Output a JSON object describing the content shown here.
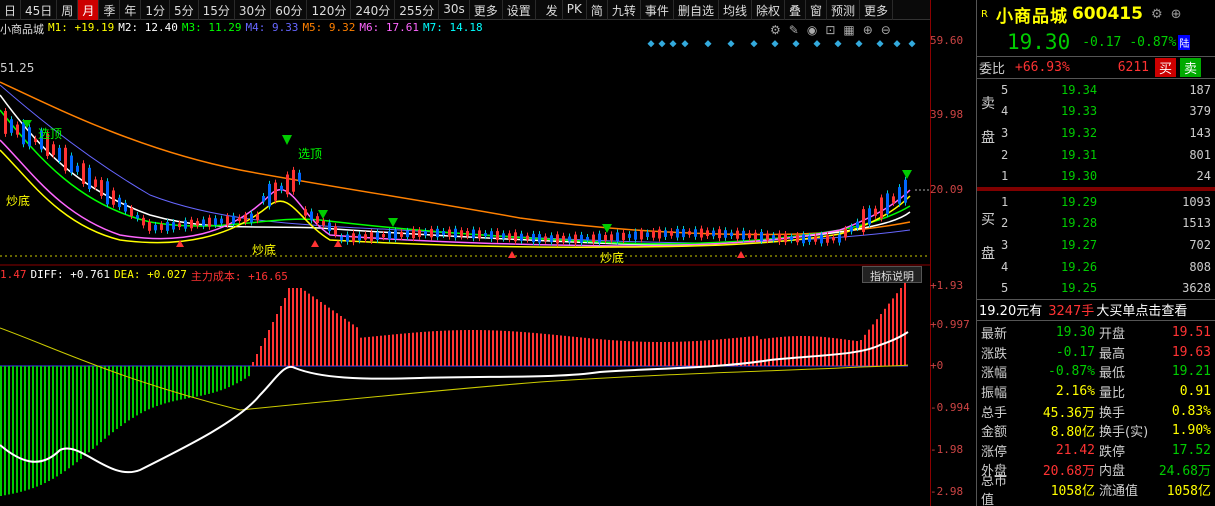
{
  "toolbar": {
    "items": [
      "日",
      "45日",
      "周",
      "月",
      "季",
      "年",
      "1分",
      "5分",
      "15分",
      "30分",
      "60分",
      "120分",
      "240分",
      "255分",
      "30s",
      "更多",
      "设置",
      "发",
      "PK",
      "简",
      "九转",
      "事件",
      "删自选",
      "均线",
      "除权",
      "叠",
      "窗",
      "预测",
      "更多"
    ],
    "active": "月"
  },
  "ma_line": {
    "name": "小商品城",
    "m1": "M1: +19.19",
    "m2": "M2: 12.40",
    "m3": "M3: 11.29",
    "m4": "M4: 9.33",
    "m5": "M5: 9.32",
    "m6": "M6: 17.61",
    "m7": "M7: 14.18"
  },
  "price_axis": [
    "59.60",
    "39.98",
    "20.09"
  ],
  "macd_axis": [
    "+1.93",
    "+0.997",
    "+0",
    "-0.994",
    "-1.98",
    "-2.98"
  ],
  "chart_annotations": {
    "high_left": "51.25",
    "top1": "选顶",
    "top2": "选顶",
    "bottom1": "炒底",
    "bottom2": "炒底",
    "bottom3": "炒底"
  },
  "macd_line": {
    "macd": "1.47",
    "diff": "DIFF: +0.761",
    "dea": "DEA: +0.027",
    "cost": "主力成本: +16.65"
  },
  "indicator_button": "指标说明",
  "quote": {
    "badge": "R",
    "name": "小商品城",
    "code": "600415",
    "price": "19.30",
    "change": "-0.17",
    "pct": "-0.87%",
    "tag": "陆",
    "weibi_label": "委比",
    "weibi": "+66.93%",
    "weicha": "6211",
    "buy": "买",
    "sell": "卖"
  },
  "asks": [
    {
      "lv": "5",
      "price": "19.34",
      "vol": "187"
    },
    {
      "lv": "4",
      "price": "19.33",
      "vol": "379"
    },
    {
      "lv": "3",
      "price": "19.32",
      "vol": "143"
    },
    {
      "lv": "2",
      "price": "19.31",
      "vol": "801"
    },
    {
      "lv": "1",
      "price": "19.30",
      "vol": "24"
    }
  ],
  "bids": [
    {
      "lv": "1",
      "price": "19.29",
      "vol": "1093"
    },
    {
      "lv": "2",
      "price": "19.28",
      "vol": "1513"
    },
    {
      "lv": "3",
      "price": "19.27",
      "vol": "702"
    },
    {
      "lv": "4",
      "price": "19.26",
      "vol": "808"
    },
    {
      "lv": "5",
      "price": "19.25",
      "vol": "3628"
    }
  ],
  "ask_label": [
    "卖",
    "盘"
  ],
  "bid_label": [
    "买",
    "盘"
  ],
  "big_order": {
    "price": "19.20元有",
    "qty": "3247手",
    "text": "大买单点击查看"
  },
  "stats": [
    {
      "l1": "最新",
      "v1": "19.30",
      "c1": "g",
      "l2": "开盘",
      "v2": "19.51",
      "c2": "rd"
    },
    {
      "l1": "涨跌",
      "v1": "-0.17",
      "c1": "g",
      "l2": "最高",
      "v2": "19.63",
      "c2": "rd"
    },
    {
      "l1": "涨幅",
      "v1": "-0.87%",
      "c1": "g",
      "l2": "最低",
      "v2": "19.21",
      "c2": "g"
    },
    {
      "l1": "振幅",
      "v1": "2.16%",
      "c1": "y",
      "l2": "量比",
      "v2": "0.91",
      "c2": "y"
    },
    {
      "l1": "总手",
      "v1": "45.36万",
      "c1": "y",
      "l2": "换手",
      "v2": "0.83%",
      "c2": "y"
    },
    {
      "l1": "金额",
      "v1": "8.80亿",
      "c1": "y",
      "l2": "换手(实)",
      "v2": "1.90%",
      "c2": "y"
    },
    {
      "l1": "涨停",
      "v1": "21.42",
      "c1": "rd",
      "l2": "跌停",
      "v2": "17.52",
      "c2": "g"
    },
    {
      "l1": "外盘",
      "v1": "20.68万",
      "c1": "rd",
      "l2": "内盘",
      "v2": "24.68万",
      "c2": "g"
    },
    {
      "l1": "总市值",
      "v1": "1058亿",
      "c1": "y",
      "l2": "流通值",
      "v2": "1058亿",
      "c2": "y"
    }
  ],
  "colors": {
    "up": "#ff3333",
    "down": "#00cc00",
    "accent": "#ffff00"
  }
}
